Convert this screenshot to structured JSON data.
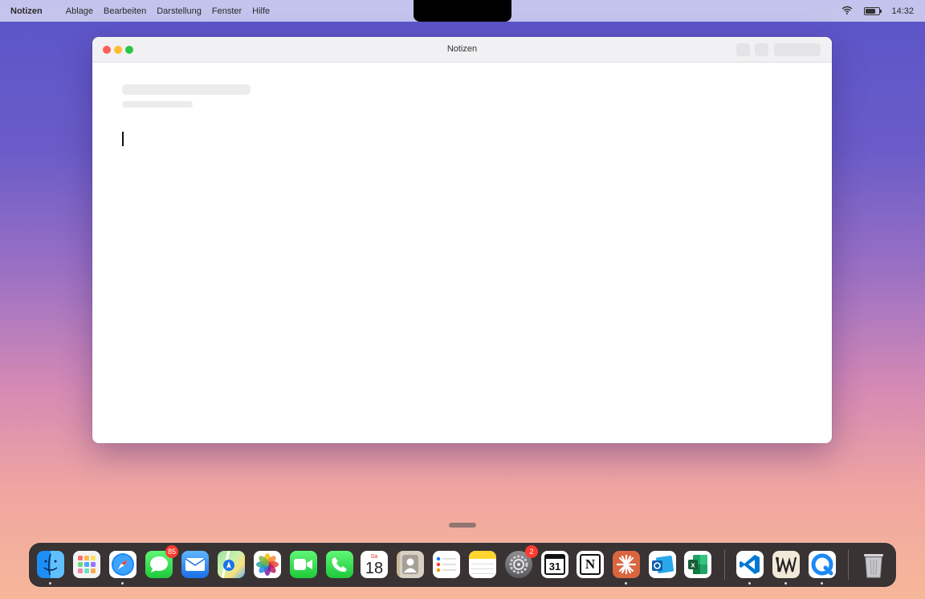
{
  "menubar": {
    "app_name": "Notizen",
    "menus": [
      "Ablage",
      "Bearbeiten",
      "Darstellung",
      "Fenster",
      "Hilfe"
    ],
    "clock": "14:32"
  },
  "window": {
    "title": "Notizen",
    "note_body": ""
  },
  "dock": {
    "apps": [
      {
        "name": "finder-icon",
        "running": true
      },
      {
        "name": "launchpad-icon",
        "running": false
      },
      {
        "name": "safari-icon",
        "running": true
      },
      {
        "name": "messages-icon",
        "running": false,
        "badge": "85"
      },
      {
        "name": "mail-icon",
        "running": false
      },
      {
        "name": "maps-icon",
        "running": false
      },
      {
        "name": "photos-icon",
        "running": false
      },
      {
        "name": "facetime-icon",
        "running": false
      },
      {
        "name": "phone-icon",
        "running": false
      },
      {
        "name": "calendar-icon",
        "running": false,
        "weekday": "Sa",
        "day": "18"
      },
      {
        "name": "contacts-icon",
        "running": false
      },
      {
        "name": "reminders-icon",
        "running": false
      },
      {
        "name": "notes-icon",
        "running": false
      },
      {
        "name": "system-settings-icon",
        "running": false,
        "badge": "2"
      },
      {
        "name": "calendar-31-icon",
        "running": false,
        "text": "31"
      },
      {
        "name": "notion-icon",
        "running": false,
        "text": "N"
      },
      {
        "name": "claude-icon",
        "running": true
      },
      {
        "name": "outlook-icon",
        "running": false
      },
      {
        "name": "excel-icon",
        "running": false
      },
      {
        "name": "vscode-icon",
        "running": true
      },
      {
        "name": "writer-icon",
        "running": true
      },
      {
        "name": "qspace-icon",
        "running": true
      },
      {
        "name": "trash-icon",
        "running": false
      }
    ]
  }
}
